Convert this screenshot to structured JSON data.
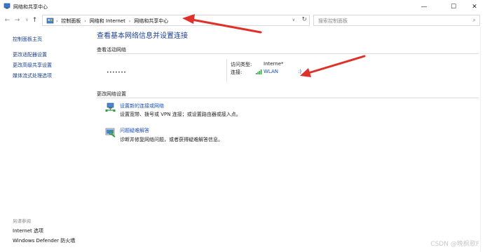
{
  "window": {
    "title": "网络和共享中心",
    "minimize_glyph": "—",
    "maximize_glyph": "☐",
    "close_glyph": "✕"
  },
  "nav": {
    "back_glyph": "←",
    "forward_glyph": "→",
    "recent_glyph": "∨",
    "up_glyph": "↑",
    "breadcrumbs": [
      "控制面板",
      "网络和 Internet",
      "网络和共享中心"
    ],
    "separator": "›",
    "dropdown_glyph": "∨",
    "refresh_glyph": "↻",
    "search_placeholder": "搜索控制面板",
    "search_glyph": "⌕"
  },
  "left_pane": {
    "links": [
      "控制面板主页",
      "更改适配器设置",
      "更改高级共享设置",
      "媒体流式处理选项"
    ],
    "see_also_label": "另请参阅",
    "see_also_links": [
      "Internet 选项",
      "Windows Defender 防火墙"
    ]
  },
  "main": {
    "title": "查看基本网络信息并设置连接",
    "active_networks_label": "查看活动网络",
    "network_name": "•••••••",
    "access_type_label": "访问类型:",
    "access_type_value": "Interne*",
    "connections_label": "连接:",
    "connection_value": "WLAN",
    "connection_trailing": ":)",
    "change_settings_label": "更改网络设置",
    "tasks": [
      {
        "icon": "network-setup-icon",
        "title": "设置新的连接或网络",
        "desc": "设置宽带、拨号或 VPN 连接；或设置路由器或接入点。"
      },
      {
        "icon": "troubleshoot-icon",
        "title": "问题疑难解答",
        "desc": "诊断并修复网络问题，或者获得疑难解答信息。"
      }
    ]
  },
  "watermark": "CSDN @晚枫歌F",
  "colors": {
    "link_blue": "#1a4fb5",
    "title_blue": "#1e3f8f",
    "annotation_red": "#e0302a"
  }
}
